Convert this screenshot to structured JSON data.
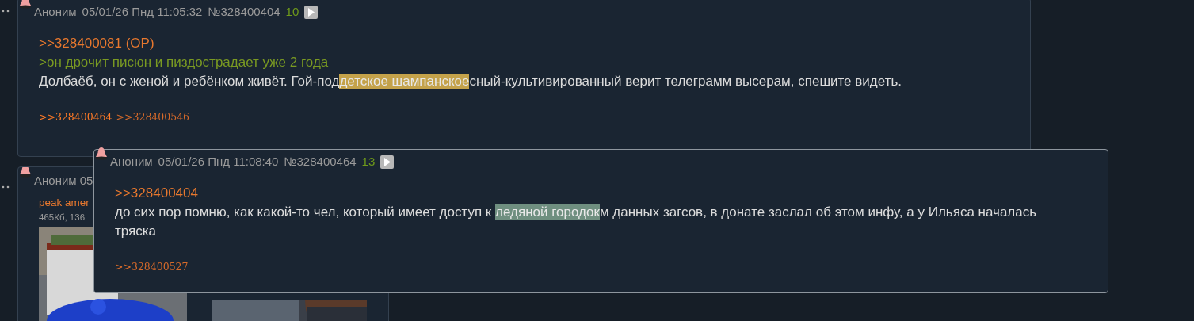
{
  "posts": [
    {
      "author": "Аноним",
      "date": "05/01/26 Пнд 11:05:32",
      "number": "№328400404",
      "count": "10",
      "lines": [
        {
          "kind": "reply",
          "text": ">>328400081 (OP)"
        },
        {
          "kind": "quote",
          "text": ">он дрочит писюн и пиздострадает уже 2 года"
        },
        {
          "kind": "text",
          "segments": [
            {
              "text": "Долбаёб, он с женой и ребёнком живёт. Гой-под"
            },
            {
              "text": "детское шампанское",
              "color": "#c4a24a"
            },
            {
              "text": "сный-культивированный верит телеграмм высерам, спешите видеть."
            }
          ]
        }
      ],
      "replies": [
        {
          "text": ">>328400464",
          "hovered": true
        },
        {
          "text": ">>328400546",
          "hovered": false
        }
      ]
    },
    {
      "header": "Аноним 05",
      "file_name": "peak amer",
      "file_info": "465Кб, 136"
    }
  ],
  "popup": {
    "author": "Аноним",
    "date": "05/01/26 Пнд 11:08:40",
    "number": "№328400464",
    "count": "13",
    "lines": [
      {
        "kind": "reply",
        "text": ">>328400404"
      },
      {
        "kind": "text",
        "segments": [
          {
            "text": "до сих пор помню, как какой-то чел, который имеет доступ к "
          },
          {
            "text": "ледяной городок",
            "color": "#6f8f80"
          },
          {
            "text": "м данных загсов, в донате заслал об этом инфу, а у Ильяса началась тряска"
          }
        ]
      }
    ],
    "replies": [
      {
        "text": ">>328400527",
        "hovered": false
      }
    ]
  }
}
